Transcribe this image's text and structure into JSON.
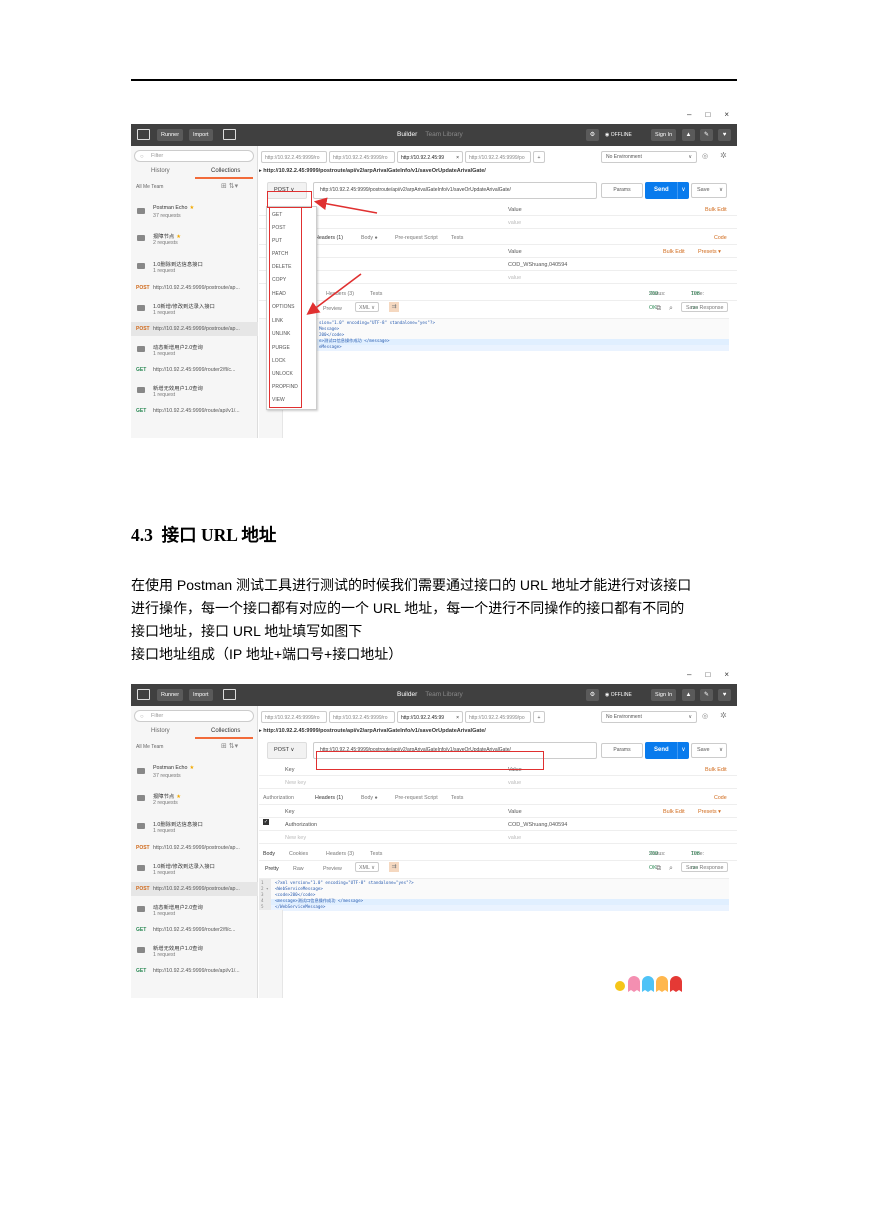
{
  "window_controls": [
    "–",
    "□",
    "×"
  ],
  "app": {
    "runner": "Runner",
    "import": "Import",
    "builder": "Builder",
    "team_library": "Team Library",
    "offline": "OFFLINE",
    "sign_in": "Sign In"
  },
  "sidebar": {
    "filter_placeholder": "Filter",
    "tab_history": "History",
    "tab_collections": "Collections",
    "filter_meta": "All  Me  Team",
    "collections": [
      {
        "name": "Postman Echo",
        "requests": "37 requests",
        "star": "★"
      },
      {
        "name": "报障节点",
        "requests": "2 requests",
        "star": "★"
      },
      {
        "name": "1.0删除到达信息接口",
        "requests": "1 request"
      }
    ],
    "req1": {
      "method": "POST",
      "url": "http://10.92.2.45:9999/postroute/ap..."
    },
    "collections2": [
      {
        "name": "1.0新增/修改到达录入接口",
        "requests": "1 request"
      }
    ],
    "req2": {
      "method": "POST",
      "url": "http://10.92.2.45:9999/postroute/ap..."
    },
    "collections3": [
      {
        "name": "动态新增用户2.0查询",
        "requests": "1 request"
      }
    ],
    "req3": {
      "method": "GET",
      "url": "http://10.92.2.45:9999/router2/fl/c..."
    },
    "collections4": [
      {
        "name": "新增无效用户1.0查询",
        "requests": "1 request"
      }
    ],
    "req4": {
      "method": "GET",
      "url": "http://10.92.2.45:9999/route/api/v1/..."
    }
  },
  "request_tabs": [
    {
      "label": "http://10.92.2.45:9999/ro"
    },
    {
      "label": "http://10.92.2.45:9999/ro"
    },
    {
      "label": "http://10.92.2.45:99",
      "close": "×"
    },
    {
      "label": "http://10.92.2.45:9999/po"
    }
  ],
  "tab_plus": "+",
  "environment": "No Environment",
  "url_title": "http://10.92.2.45:9999/postroute/api/v2/arpArivalGateInfo/v1/saveOrUpdateArivalGate/",
  "method": "POST",
  "url": "http://10.92.2.45:9999/postroute/api/v2/arpArivalGateInfo/v1/saveOrUpdateArivalGate/",
  "params": "Params",
  "send": "Send",
  "save": "Save",
  "kv": {
    "key": "Key",
    "value": "Value",
    "new_key": "New key",
    "value_ph": "value",
    "bulk_edit": "Bulk Edit",
    "presets": "Presets ▾"
  },
  "sections": {
    "authorization": "Authorization",
    "headers": "Headers (1)",
    "body": "Body ●",
    "pre_request": "Pre-request Script",
    "tests": "Tests",
    "code": "Code",
    "headers_short": "Headers (1)"
  },
  "header_row": {
    "key": "Authorization",
    "value": "COD_WShuang,040594"
  },
  "response": {
    "body": "Body",
    "cookies": "Cookies",
    "headers": "Headers (3)",
    "tests": "Tests",
    "status_label": "Status:",
    "status": "200 OK",
    "time_label": "Time:",
    "time": "108 ms",
    "pretty": "Pretty",
    "raw": "Raw",
    "preview": "Preview",
    "xml": "XML ∨",
    "save_response": "Save Response",
    "headers_partial": "Headers (3)",
    "tests_partial": "Tests"
  },
  "code_lines": [
    {
      "n": "1",
      "text": "<?xml version=\"1.0\" encoding=\"UTF-8\" standalone=\"yes\"?>"
    },
    {
      "n": "2 ▾",
      "text": "<WebServiceMessage>"
    },
    {
      "n": "3",
      "text": "    <code>200</code>"
    },
    {
      "n": "4",
      "text": "    <message>测试口信息操作成功 </message>"
    },
    {
      "n": "5",
      "text": "</WebServiceMessage>"
    }
  ],
  "code_lines_partial": [
    {
      "text": "sion=\"1.0\" encoding=\"UTF-8\" standalone=\"yes\"?>"
    },
    {
      "text": "Message>"
    },
    {
      "text": "200</code>"
    },
    {
      "text": "e>测试口信息操作成功 </message>"
    },
    {
      "text": "eMessage>"
    }
  ],
  "headers_partial_label": "Headers (1)",
  "method_menu": [
    "GET",
    "POST",
    "PUT",
    "PATCH",
    "DELETE",
    "COPY",
    "HEAD",
    "OPTIONS",
    "LINK",
    "UNLINK",
    "PURGE",
    "LOCK",
    "UNLOCK",
    "PROPFIND",
    "VIEW"
  ],
  "heading": {
    "number": "4.3",
    "title": "接口 URL 地址"
  },
  "paragraph_lines": [
    "在使用 Postman 测试工具进行测试的时候我们需要通过接口的 URL 地址才能进行对该接口",
    "进行操作，每一个接口都有对应的一个 URL 地址，每一个进行不同操作的接口都有不同的",
    "接口地址，接口 URL 地址填写如图下",
    "接口地址组成（IP 地址+端口号+接口地址）"
  ],
  "colors": {
    "accent_orange": "#f26b3a",
    "send_blue": "#097bed",
    "highlight_red": "#e03030",
    "topbar": "#404040"
  }
}
